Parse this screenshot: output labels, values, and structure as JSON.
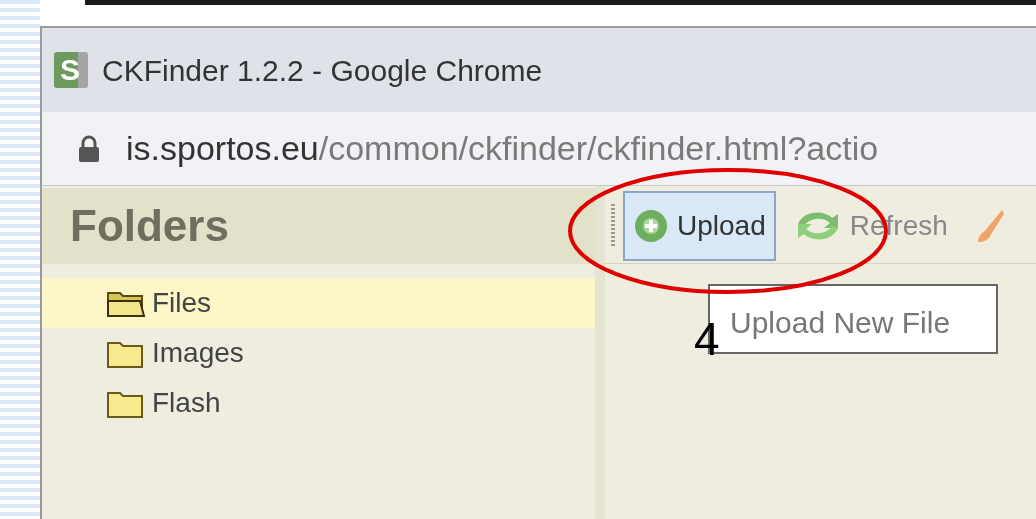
{
  "window": {
    "title": "CKFinder 1.2.2 - Google Chrome",
    "favicon": "S"
  },
  "address_bar": {
    "host": "is.sportos.eu",
    "path": "/common/ckfinder/ckfinder.html?actio"
  },
  "folders": {
    "title": "Folders",
    "items": [
      {
        "label": "Files",
        "selected": true
      },
      {
        "label": "Images",
        "selected": false
      },
      {
        "label": "Flash",
        "selected": false
      }
    ]
  },
  "toolbar": {
    "buttons": [
      {
        "kind": "upload",
        "label": "Upload",
        "selected": true
      },
      {
        "kind": "refresh",
        "label": "Refresh",
        "selected": false
      },
      {
        "kind": "brush"
      }
    ]
  },
  "tooltip": "Upload New File",
  "annotation": {
    "number": "4"
  }
}
